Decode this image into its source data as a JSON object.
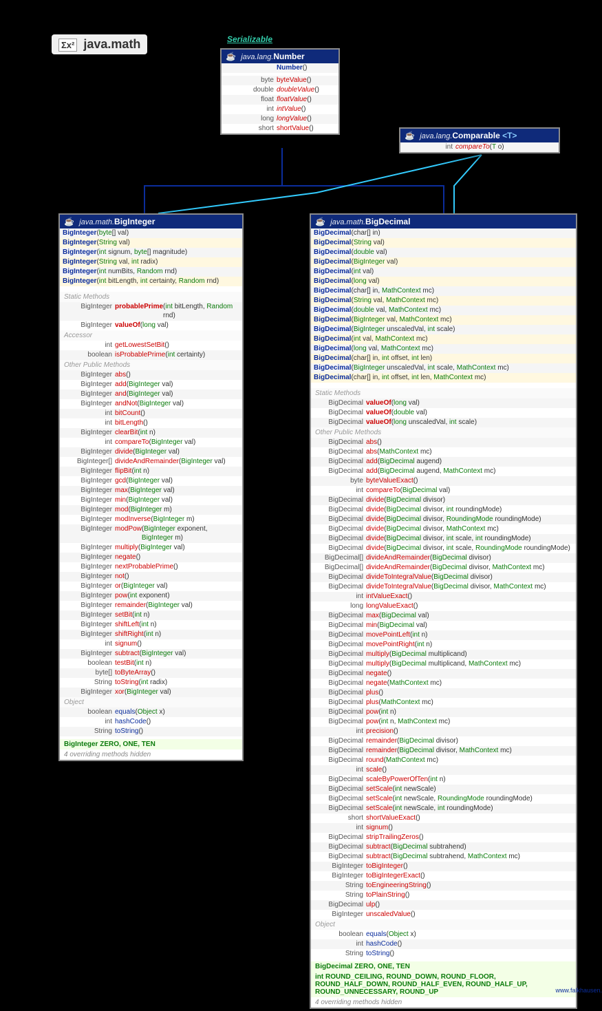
{
  "page_title": "java.math",
  "serializable": "Serializable",
  "attrib": "www.falkhausen.de",
  "number": {
    "pkg": "java.lang.",
    "name": "Number",
    "ctors": [
      {
        "name": "Number",
        "params": "()"
      }
    ],
    "methods": [
      {
        "ret": "byte",
        "name": "byteValue",
        "params": "()"
      },
      {
        "ret": "double",
        "name": "doubleValue",
        "params": "()",
        "abs": true
      },
      {
        "ret": "float",
        "name": "floatValue",
        "params": "()",
        "abs": true
      },
      {
        "ret": "int",
        "name": "intValue",
        "params": "()",
        "abs": true
      },
      {
        "ret": "long",
        "name": "longValue",
        "params": "()",
        "abs": true
      },
      {
        "ret": "short",
        "name": "shortValue",
        "params": "()"
      }
    ]
  },
  "comparable": {
    "pkg": "java.lang.",
    "name": "Comparable",
    "gen": "<T>",
    "methods": [
      {
        "ret": "int",
        "name": "compareTo",
        "params": "(T o)",
        "abs": true
      }
    ]
  },
  "biginteger": {
    "pkg": "java.math.",
    "name": "BigInteger",
    "ctors": [
      {
        "p": "(byte[] val)"
      },
      {
        "p": "(String val)"
      },
      {
        "p": "(int signum, byte[] magnitude)"
      },
      {
        "p": "(String val, int radix)"
      },
      {
        "p": "(int numBits, Random rnd)"
      },
      {
        "p": "(int bitLength, int certainty, Random rnd)"
      }
    ],
    "sections": [
      {
        "title": "Static Methods",
        "m": [
          {
            "r": "BigInteger",
            "n": "probablePrime",
            "p": "(int bitLength, Random rnd)",
            "bold": true
          },
          {
            "r": "BigInteger",
            "n": "valueOf",
            "p": "(long val)",
            "bold": true
          }
        ]
      },
      {
        "title": "Accessor",
        "m": [
          {
            "r": "int",
            "n": "getLowestSetBit",
            "p": "()"
          },
          {
            "r": "boolean",
            "n": "isProbablePrime",
            "p": "(int certainty)"
          }
        ]
      },
      {
        "title": "Other Public Methods",
        "m": [
          {
            "r": "BigInteger",
            "n": "abs",
            "p": "()"
          },
          {
            "r": "BigInteger",
            "n": "add",
            "p": "(BigInteger val)"
          },
          {
            "r": "BigInteger",
            "n": "and",
            "p": "(BigInteger val)"
          },
          {
            "r": "BigInteger",
            "n": "andNot",
            "p": "(BigInteger val)"
          },
          {
            "r": "int",
            "n": "bitCount",
            "p": "()"
          },
          {
            "r": "int",
            "n": "bitLength",
            "p": "()"
          },
          {
            "r": "BigInteger",
            "n": "clearBit",
            "p": "(int n)"
          },
          {
            "r": "int",
            "n": "compareTo",
            "p": "(BigInteger val)"
          },
          {
            "r": "BigInteger",
            "n": "divide",
            "p": "(BigInteger val)"
          },
          {
            "r": "BigInteger[]",
            "n": "divideAndRemainder",
            "p": "(BigInteger val)"
          },
          {
            "r": "BigInteger",
            "n": "flipBit",
            "p": "(int n)"
          },
          {
            "r": "BigInteger",
            "n": "gcd",
            "p": "(BigInteger val)"
          },
          {
            "r": "BigInteger",
            "n": "max",
            "p": "(BigInteger val)"
          },
          {
            "r": "BigInteger",
            "n": "min",
            "p": "(BigInteger val)"
          },
          {
            "r": "BigInteger",
            "n": "mod",
            "p": "(BigInteger m)"
          },
          {
            "r": "BigInteger",
            "n": "modInverse",
            "p": "(BigInteger m)"
          },
          {
            "r": "BigInteger",
            "n": "modPow",
            "p": "(BigInteger exponent, BigInteger m)"
          },
          {
            "r": "BigInteger",
            "n": "multiply",
            "p": "(BigInteger val)"
          },
          {
            "r": "BigInteger",
            "n": "negate",
            "p": "()"
          },
          {
            "r": "BigInteger",
            "n": "nextProbablePrime",
            "p": "()"
          },
          {
            "r": "BigInteger",
            "n": "not",
            "p": "()"
          },
          {
            "r": "BigInteger",
            "n": "or",
            "p": "(BigInteger val)"
          },
          {
            "r": "BigInteger",
            "n": "pow",
            "p": "(int exponent)"
          },
          {
            "r": "BigInteger",
            "n": "remainder",
            "p": "(BigInteger val)"
          },
          {
            "r": "BigInteger",
            "n": "setBit",
            "p": "(int n)"
          },
          {
            "r": "BigInteger",
            "n": "shiftLeft",
            "p": "(int n)"
          },
          {
            "r": "BigInteger",
            "n": "shiftRight",
            "p": "(int n)"
          },
          {
            "r": "int",
            "n": "signum",
            "p": "()"
          },
          {
            "r": "BigInteger",
            "n": "subtract",
            "p": "(BigInteger val)"
          },
          {
            "r": "boolean",
            "n": "testBit",
            "p": "(int n)"
          },
          {
            "r": "byte[]",
            "n": "toByteArray",
            "p": "()"
          },
          {
            "r": "String",
            "n": "toString",
            "p": "(int radix)"
          },
          {
            "r": "BigInteger",
            "n": "xor",
            "p": "(BigInteger val)"
          }
        ]
      },
      {
        "title": "Object",
        "m": [
          {
            "r": "boolean",
            "n": "equals",
            "p": "(Object x)",
            "blue": true
          },
          {
            "r": "int",
            "n": "hashCode",
            "p": "()",
            "blue": true
          },
          {
            "r": "String",
            "n": "toString",
            "p": "()",
            "blue": true
          }
        ]
      }
    ],
    "consts": "BigInteger ZERO, ONE, TEN",
    "footer": "4 overriding methods hidden"
  },
  "bigdecimal": {
    "pkg": "java.math.",
    "name": "BigDecimal",
    "ctors": [
      {
        "p": "(char[] in)"
      },
      {
        "p": "(String val)"
      },
      {
        "p": "(double val)"
      },
      {
        "p": "(BigInteger val)"
      },
      {
        "p": "(int val)"
      },
      {
        "p": "(long val)"
      },
      {
        "p": "(char[] in, MathContext mc)"
      },
      {
        "p": "(String val, MathContext mc)"
      },
      {
        "p": "(double val, MathContext mc)"
      },
      {
        "p": "(BigInteger val, MathContext mc)"
      },
      {
        "p": "(BigInteger unscaledVal, int scale)"
      },
      {
        "p": "(int val, MathContext mc)"
      },
      {
        "p": "(long val, MathContext mc)"
      },
      {
        "p": "(char[] in, int offset, int len)"
      },
      {
        "p": "(BigInteger unscaledVal, int scale, MathContext mc)"
      },
      {
        "p": "(char[] in, int offset, int len, MathContext mc)"
      }
    ],
    "sections": [
      {
        "title": "Static Methods",
        "m": [
          {
            "r": "BigDecimal",
            "n": "valueOf",
            "p": "(long val)",
            "bold": true
          },
          {
            "r": "BigDecimal",
            "n": "valueOf",
            "p": "(double val)",
            "bold": true
          },
          {
            "r": "BigDecimal",
            "n": "valueOf",
            "p": "(long unscaledVal, int scale)",
            "bold": true
          }
        ]
      },
      {
        "title": "Other Public Methods",
        "m": [
          {
            "r": "BigDecimal",
            "n": "abs",
            "p": "()"
          },
          {
            "r": "BigDecimal",
            "n": "abs",
            "p": "(MathContext mc)"
          },
          {
            "r": "BigDecimal",
            "n": "add",
            "p": "(BigDecimal augend)"
          },
          {
            "r": "BigDecimal",
            "n": "add",
            "p": "(BigDecimal augend, MathContext mc)"
          },
          {
            "r": "byte",
            "n": "byteValueExact",
            "p": "()"
          },
          {
            "r": "int",
            "n": "compareTo",
            "p": "(BigDecimal val)"
          },
          {
            "r": "BigDecimal",
            "n": "divide",
            "p": "(BigDecimal divisor)"
          },
          {
            "r": "BigDecimal",
            "n": "divide",
            "p": "(BigDecimal divisor, int roundingMode)"
          },
          {
            "r": "BigDecimal",
            "n": "divide",
            "p": "(BigDecimal divisor, RoundingMode roundingMode)"
          },
          {
            "r": "BigDecimal",
            "n": "divide",
            "p": "(BigDecimal divisor, MathContext mc)"
          },
          {
            "r": "BigDecimal",
            "n": "divide",
            "p": "(BigDecimal divisor, int scale, int roundingMode)"
          },
          {
            "r": "BigDecimal",
            "n": "divide",
            "p": "(BigDecimal divisor, int scale, RoundingMode roundingMode)"
          },
          {
            "r": "BigDecimal[]",
            "n": "divideAndRemainder",
            "p": "(BigDecimal divisor)"
          },
          {
            "r": "BigDecimal[]",
            "n": "divideAndRemainder",
            "p": "(BigDecimal divisor, MathContext mc)"
          },
          {
            "r": "BigDecimal",
            "n": "divideToIntegralValue",
            "p": "(BigDecimal divisor)"
          },
          {
            "r": "BigDecimal",
            "n": "divideToIntegralValue",
            "p": "(BigDecimal divisor, MathContext mc)"
          },
          {
            "r": "int",
            "n": "intValueExact",
            "p": "()"
          },
          {
            "r": "long",
            "n": "longValueExact",
            "p": "()"
          },
          {
            "r": "BigDecimal",
            "n": "max",
            "p": "(BigDecimal val)"
          },
          {
            "r": "BigDecimal",
            "n": "min",
            "p": "(BigDecimal val)"
          },
          {
            "r": "BigDecimal",
            "n": "movePointLeft",
            "p": "(int n)"
          },
          {
            "r": "BigDecimal",
            "n": "movePointRight",
            "p": "(int n)"
          },
          {
            "r": "BigDecimal",
            "n": "multiply",
            "p": "(BigDecimal multiplicand)"
          },
          {
            "r": "BigDecimal",
            "n": "multiply",
            "p": "(BigDecimal multiplicand, MathContext mc)"
          },
          {
            "r": "BigDecimal",
            "n": "negate",
            "p": "()"
          },
          {
            "r": "BigDecimal",
            "n": "negate",
            "p": "(MathContext mc)"
          },
          {
            "r": "BigDecimal",
            "n": "plus",
            "p": "()"
          },
          {
            "r": "BigDecimal",
            "n": "plus",
            "p": "(MathContext mc)"
          },
          {
            "r": "BigDecimal",
            "n": "pow",
            "p": "(int n)"
          },
          {
            "r": "BigDecimal",
            "n": "pow",
            "p": "(int n, MathContext mc)"
          },
          {
            "r": "int",
            "n": "precision",
            "p": "()"
          },
          {
            "r": "BigDecimal",
            "n": "remainder",
            "p": "(BigDecimal divisor)"
          },
          {
            "r": "BigDecimal",
            "n": "remainder",
            "p": "(BigDecimal divisor, MathContext mc)"
          },
          {
            "r": "BigDecimal",
            "n": "round",
            "p": "(MathContext mc)"
          },
          {
            "r": "int",
            "n": "scale",
            "p": "()"
          },
          {
            "r": "BigDecimal",
            "n": "scaleByPowerOfTen",
            "p": "(int n)"
          },
          {
            "r": "BigDecimal",
            "n": "setScale",
            "p": "(int newScale)"
          },
          {
            "r": "BigDecimal",
            "n": "setScale",
            "p": "(int newScale, RoundingMode roundingMode)"
          },
          {
            "r": "BigDecimal",
            "n": "setScale",
            "p": "(int newScale, int roundingMode)"
          },
          {
            "r": "short",
            "n": "shortValueExact",
            "p": "()"
          },
          {
            "r": "int",
            "n": "signum",
            "p": "()"
          },
          {
            "r": "BigDecimal",
            "n": "stripTrailingZeros",
            "p": "()"
          },
          {
            "r": "BigDecimal",
            "n": "subtract",
            "p": "(BigDecimal subtrahend)"
          },
          {
            "r": "BigDecimal",
            "n": "subtract",
            "p": "(BigDecimal subtrahend, MathContext mc)"
          },
          {
            "r": "BigInteger",
            "n": "toBigInteger",
            "p": "()"
          },
          {
            "r": "BigInteger",
            "n": "toBigIntegerExact",
            "p": "()"
          },
          {
            "r": "String",
            "n": "toEngineeringString",
            "p": "()"
          },
          {
            "r": "String",
            "n": "toPlainString",
            "p": "()"
          },
          {
            "r": "BigDecimal",
            "n": "ulp",
            "p": "()"
          },
          {
            "r": "BigInteger",
            "n": "unscaledValue",
            "p": "()"
          }
        ]
      },
      {
        "title": "Object",
        "m": [
          {
            "r": "boolean",
            "n": "equals",
            "p": "(Object x)",
            "blue": true
          },
          {
            "r": "int",
            "n": "hashCode",
            "p": "()",
            "blue": true
          },
          {
            "r": "String",
            "n": "toString",
            "p": "()",
            "blue": true
          }
        ]
      }
    ],
    "consts1": "BigDecimal ZERO, ONE, TEN",
    "consts2": "int ROUND_CEILING, ROUND_DOWN, ROUND_FLOOR, ROUND_HALF_DOWN, ROUND_HALF_EVEN, ROUND_HALF_UP, ROUND_UNNECESSARY, ROUND_UP",
    "footer": "4 overriding methods hidden"
  }
}
